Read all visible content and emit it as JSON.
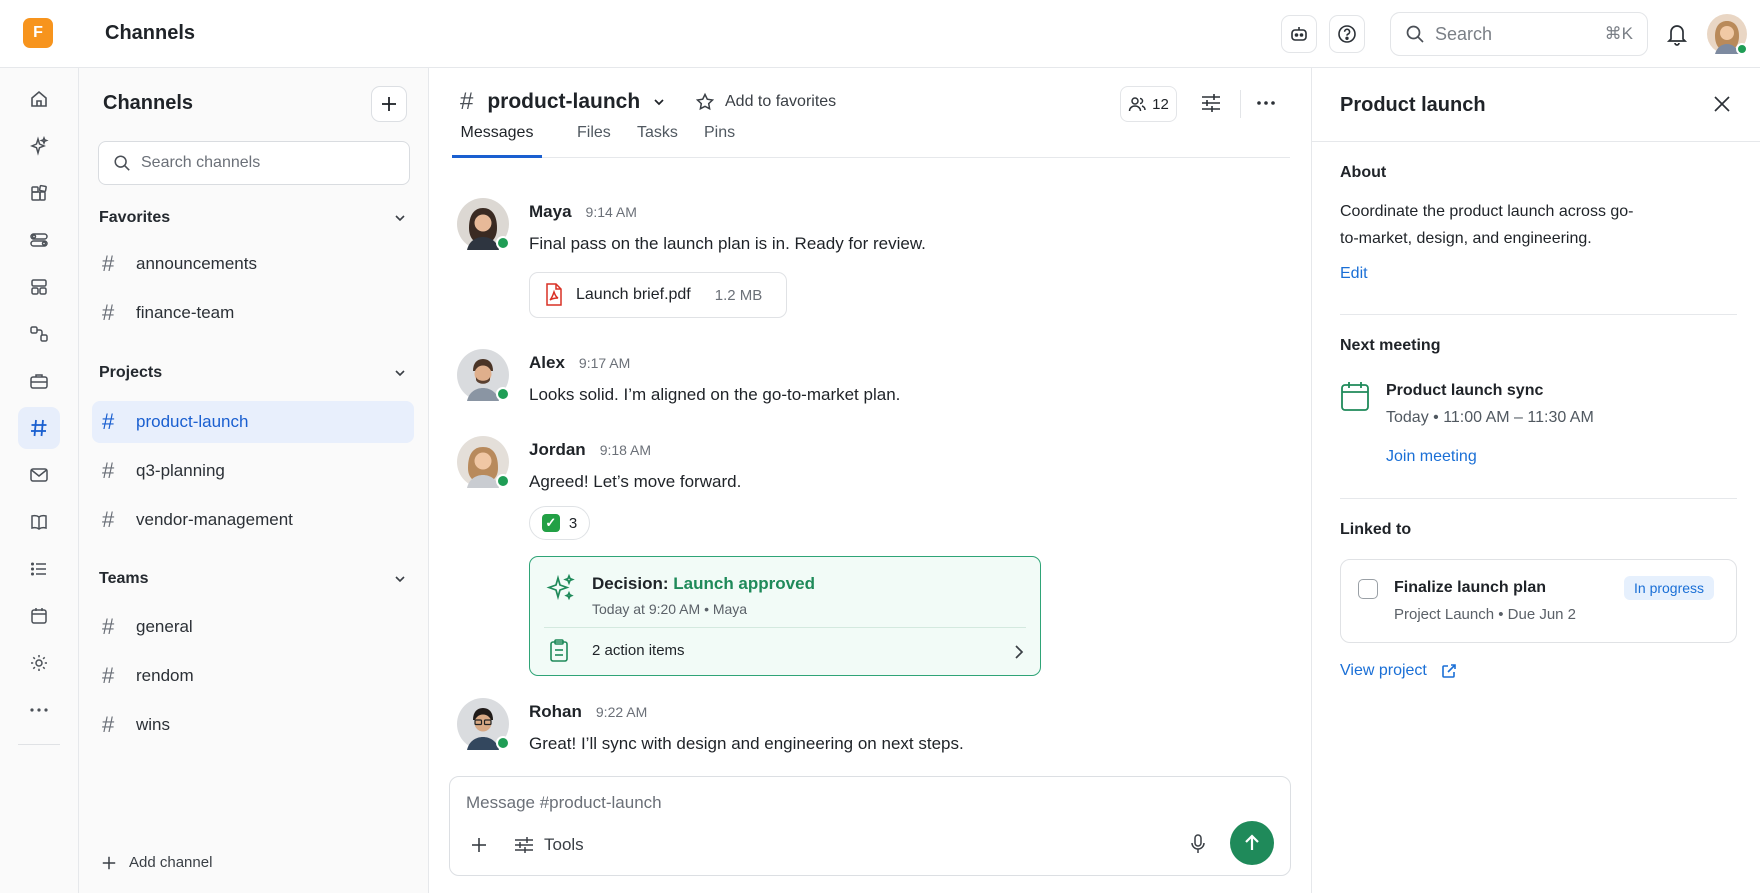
{
  "app": {
    "logo_letter": "F",
    "title": "Channels"
  },
  "topbar": {
    "search_placeholder": "Search",
    "search_shortcut": "⌘K",
    "icons": [
      "bot-icon",
      "help-icon",
      "search-icon",
      "bell-icon",
      "user-avatar"
    ]
  },
  "rail": {
    "items": [
      "home-icon",
      "sparkle-icon",
      "apps-icon",
      "toggles-icon",
      "layout-icon",
      "workflow-icon",
      "briefcase-icon",
      "hash-icon",
      "mail-icon",
      "book-icon",
      "list-icon",
      "calendar-icon",
      "settings-icon",
      "more-icon"
    ],
    "active": "hash-icon"
  },
  "sidebar": {
    "title": "Channels",
    "search_placeholder": "Search channels",
    "sections": [
      {
        "label": "Favorites",
        "channels": [
          "announcements",
          "finance-team"
        ]
      },
      {
        "label": "Projects",
        "channels": [
          "product-launch",
          "q3-planning",
          "vendor-management"
        ]
      },
      {
        "label": "Teams",
        "channels": [
          "general",
          "rendom",
          "wins"
        ]
      }
    ],
    "active_channel": "product-launch",
    "add_channel": "Add channel"
  },
  "channel": {
    "name": "product-launch",
    "favorite_label": "Add to favorites",
    "member_count": "12",
    "tabs": [
      "Messages",
      "Files",
      "Tasks",
      "Pins"
    ],
    "active_tab": "Messages"
  },
  "messages": [
    {
      "author": "Maya",
      "time": "9:14 AM",
      "text": "Final pass on the launch plan is in. Ready for review.",
      "attachment": {
        "name": "Launch brief.pdf",
        "size": "1.2 MB"
      }
    },
    {
      "author": "Alex",
      "time": "9:17 AM",
      "text": "Looks solid. I’m aligned on the go-to-market plan."
    },
    {
      "author": "Jordan",
      "time": "9:18 AM",
      "text": "Agreed! Let’s move forward.",
      "reaction": {
        "emoji": "✓",
        "count": "3"
      },
      "decision": {
        "label": "Decision:",
        "value": "Launch approved",
        "meta": "Today at 9:20 AM • Maya",
        "action_items": "2 action items"
      }
    },
    {
      "author": "Rohan",
      "time": "9:22 AM",
      "text": "Great! I’ll sync with design and engineering on next steps."
    }
  ],
  "composer": {
    "placeholder": "Message #product-launch",
    "tools_label": "Tools"
  },
  "panel": {
    "title": "Product launch",
    "about_label": "About",
    "about_text": "Coordinate the product launch across go-to-market, design, and engineering.",
    "edit_label": "Edit",
    "next_meeting_label": "Next meeting",
    "meeting_title": "Product launch sync",
    "meeting_time": "Today • 11:00 AM – 11:30 AM",
    "join_label": "Join meeting",
    "linked_label": "Linked to",
    "task": {
      "title": "Finalize launch plan",
      "status": "In progress",
      "meta": "Project Launch • Due Jun 2"
    },
    "view_project": "View project"
  },
  "colors": {
    "accent": "#1a5fd0",
    "success": "#1f8a5a",
    "logo": "#f7941d",
    "online": "#1f9d55"
  }
}
